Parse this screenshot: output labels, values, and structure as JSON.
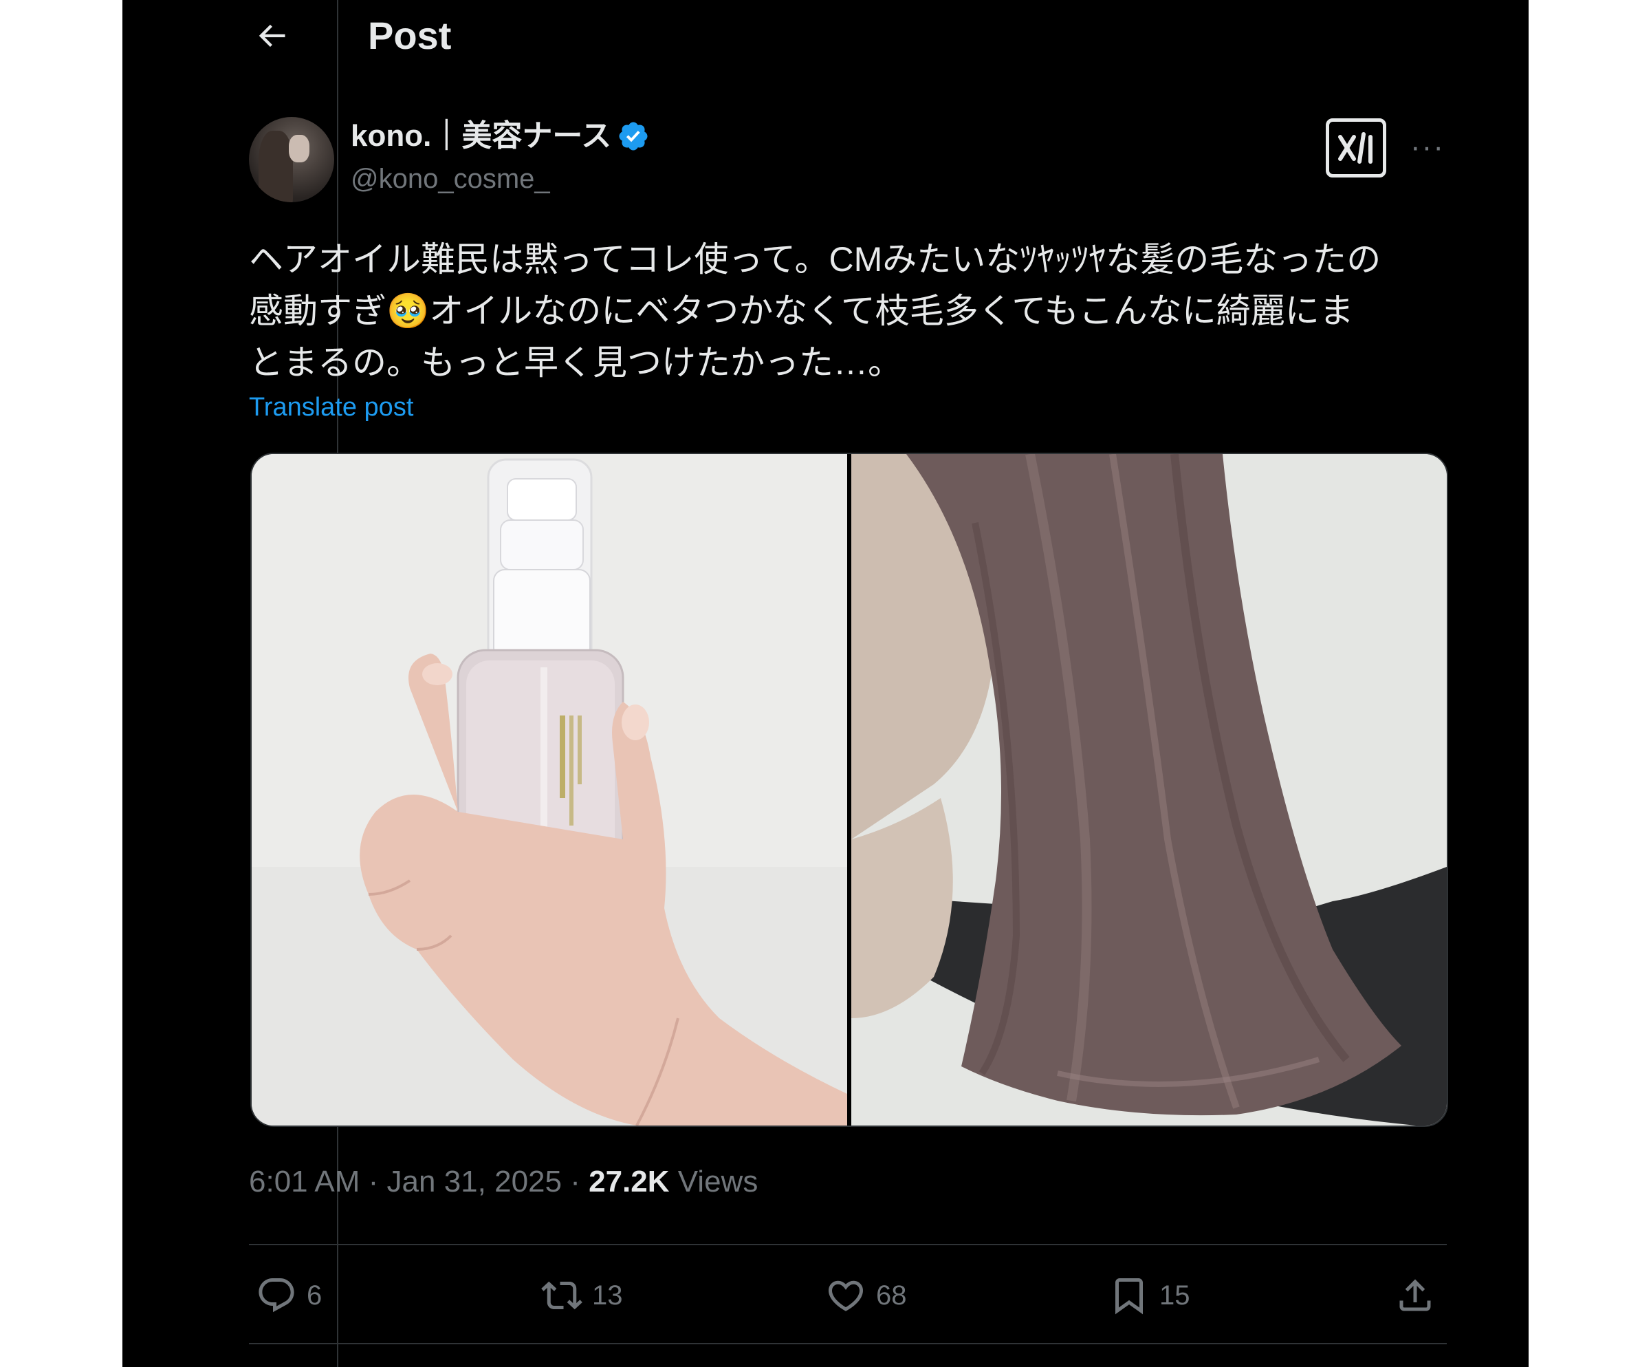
{
  "header": {
    "title": "Post",
    "back_icon": "arrow-left-icon"
  },
  "author": {
    "display_name": "kono.｜美容ナース",
    "handle": "@kono_cosme_",
    "verified": true,
    "verified_color": "#1d9bf0"
  },
  "post": {
    "text": "ヘアオイル難民は黙ってコレ使って。CMみたいなﾂﾔｯﾂﾔな髪の毛なったの\n感動すぎ🥹オイルなのにベタつかなくて枝毛多くてもこんなに綺麗にま\nとまるの。もっと早く見つけたかった…。",
    "translate_label": "Translate post",
    "images": [
      {
        "icon": "product-photo-oil-bottle"
      },
      {
        "icon": "product-photo-hair"
      }
    ]
  },
  "meta": {
    "time": "6:01 AM",
    "separator": " · ",
    "date": "Jan 31, 2025",
    "separator2": " · ",
    "views_count": "27.2K",
    "views_label": " Views"
  },
  "actions": {
    "reply": {
      "icon": "reply-icon",
      "count": "6"
    },
    "repost": {
      "icon": "repost-icon",
      "count": "13"
    },
    "like": {
      "icon": "heart-icon",
      "count": "68"
    },
    "bookmark": {
      "icon": "bookmark-icon",
      "count": "15"
    },
    "share": {
      "icon": "share-icon"
    }
  },
  "colors": {
    "background": "#000000",
    "text": "#e7e9ea",
    "secondary_text": "#71767b",
    "link": "#1d9bf0",
    "border": "#2f3336"
  }
}
